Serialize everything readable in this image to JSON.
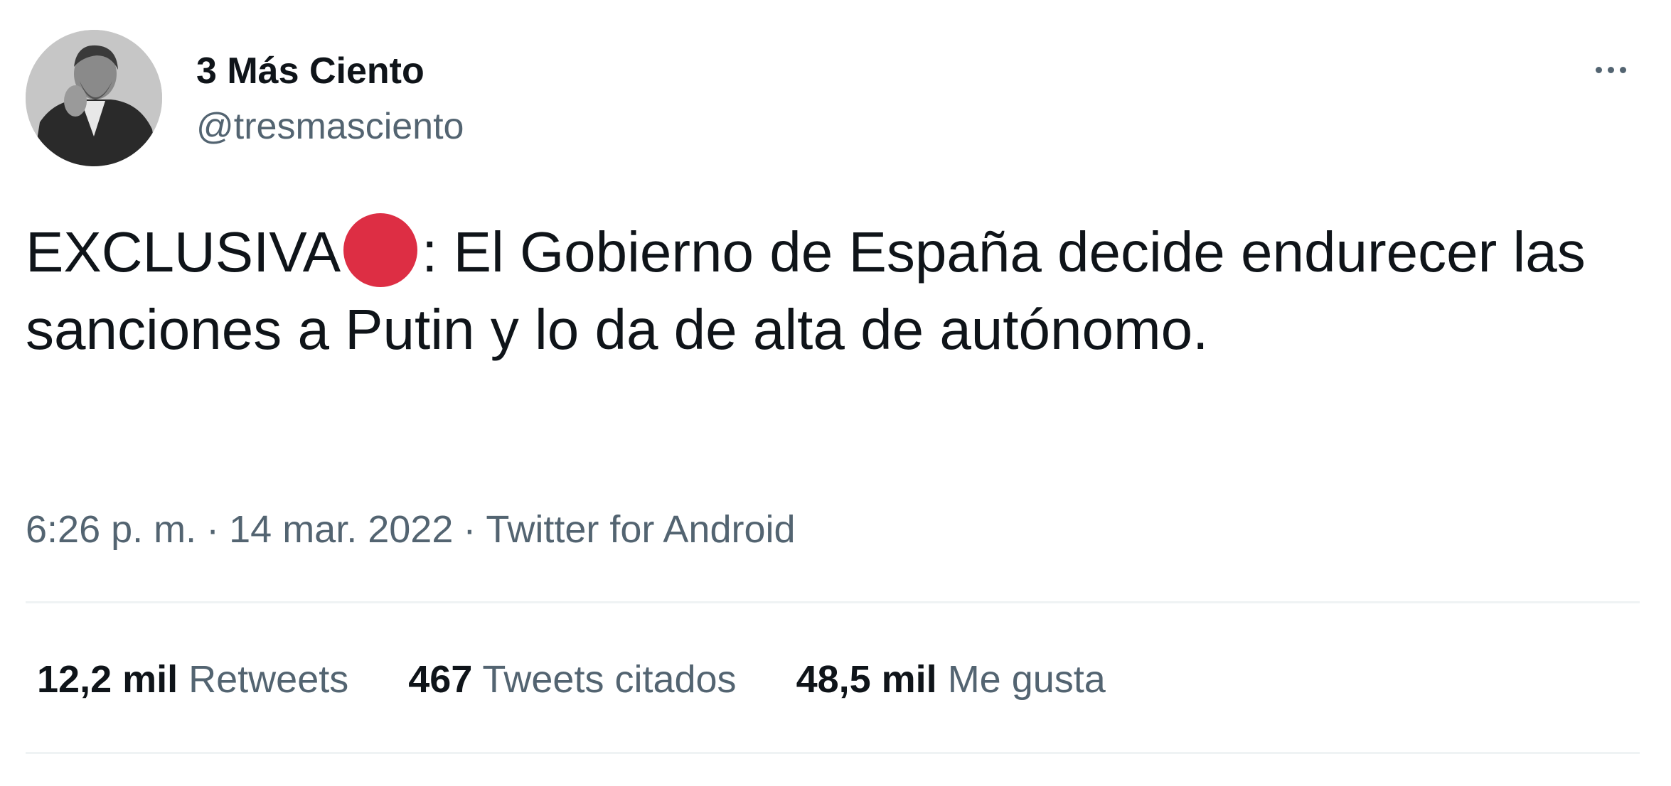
{
  "user": {
    "display_name": "3 Más Ciento",
    "handle": "@tresmasciento",
    "avatar": "avatar-photo"
  },
  "tweet": {
    "text_before": "EXCLUSIVA",
    "emoji": "red-circle-emoji",
    "text_after": ": El Gobierno de España decide endurecer las sanciones a Putin y lo da de alta de autónomo."
  },
  "meta": {
    "time": "6:26 p. m.",
    "separator": "·",
    "date": "14 mar. 2022",
    "source": "Twitter for Android"
  },
  "stats": {
    "retweets_count": "12,2 mil",
    "retweets_label": "Retweets",
    "quotes_count": "467",
    "quotes_label": "Tweets citados",
    "likes_count": "48,5 mil",
    "likes_label": "Me gusta"
  },
  "icons": {
    "more": "more-options-icon"
  },
  "colors": {
    "text_primary": "#0f1419",
    "text_secondary": "#536471",
    "divider": "#eff3f4",
    "red_circle": "#dd2e44"
  }
}
